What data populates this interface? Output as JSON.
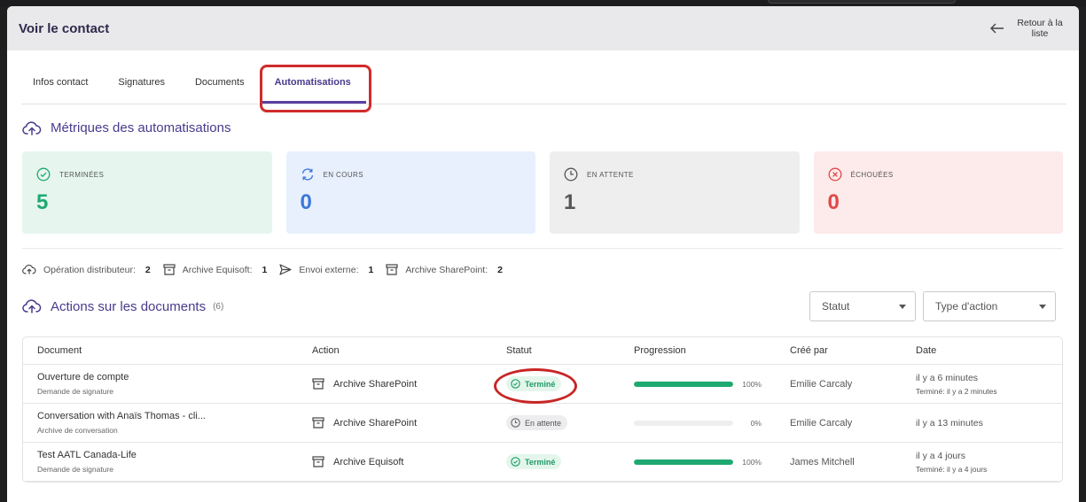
{
  "header": {
    "title": "Voir le contact",
    "back_label": "Retour à la liste"
  },
  "tabs": [
    {
      "label": "Infos contact"
    },
    {
      "label": "Signatures"
    },
    {
      "label": "Documents"
    },
    {
      "label": "Automatisations"
    }
  ],
  "metrics": {
    "title": "Métriques des automatisations",
    "cards": [
      {
        "label": "TERMINÉES",
        "value": "5",
        "icon": "check-circle-icon"
      },
      {
        "label": "EN COURS",
        "value": "0",
        "icon": "refresh-icon"
      },
      {
        "label": "EN ATTENTE",
        "value": "1",
        "icon": "clock-icon"
      },
      {
        "label": "ÉCHOUÉES",
        "value": "0",
        "icon": "x-circle-icon"
      }
    ]
  },
  "operations": [
    {
      "label": "Opération distributeur:",
      "count": "2",
      "icon": "cloud-upload-icon"
    },
    {
      "label": "Archive Equisoft:",
      "count": "1",
      "icon": "archive-icon"
    },
    {
      "label": "Envoi externe:",
      "count": "1",
      "icon": "send-icon"
    },
    {
      "label": "Archive SharePoint:",
      "count": "2",
      "icon": "archive-icon"
    }
  ],
  "actions": {
    "title": "Actions sur les documents",
    "count": "(6)",
    "filter_status": "Statut",
    "filter_type": "Type d'action"
  },
  "table": {
    "headers": {
      "document": "Document",
      "action": "Action",
      "status": "Statut",
      "progress": "Progression",
      "created_by": "Créé par",
      "date": "Date"
    },
    "rows": [
      {
        "doc": "Ouverture de compte",
        "doc_sub": "Demande de signature",
        "action": "Archive SharePoint",
        "status": "Terminé",
        "progress": 1.0,
        "progress_label": "100%",
        "by": "Emilie Carcaly",
        "date": "il y a 6 minutes",
        "date_sub": "Terminé: il y a 2 minutes"
      },
      {
        "doc": "Conversation with Anaïs Thomas - cli...",
        "doc_sub": "Archive de conversation",
        "action": "Archive SharePoint",
        "status": "En attente",
        "progress": 0,
        "progress_label": "0%",
        "by": "Emilie Carcaly",
        "date": "il y a 13 minutes",
        "date_sub": ""
      },
      {
        "doc": "Test AATL Canada-Life",
        "doc_sub": "Demande de signature",
        "action": "Archive Equisoft",
        "status": "Terminé",
        "progress": 1.0,
        "progress_label": "100%",
        "by": "James Mitchell",
        "date": "il y a 4 jours",
        "date_sub": "Terminé: il y a 4 jours"
      }
    ]
  },
  "colors": {
    "accent": "#5b3f9e",
    "success": "#1ea971",
    "info": "#3a78d8",
    "danger": "#e04848",
    "highlight": "#d12b2b"
  }
}
